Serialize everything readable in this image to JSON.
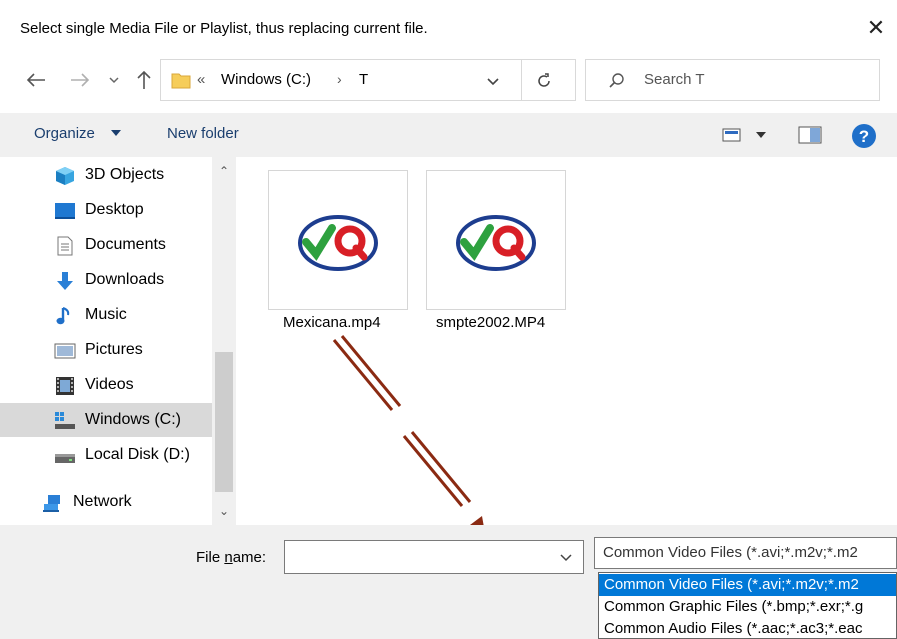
{
  "window": {
    "title": "Select single Media File or Playlist, thus replacing current file."
  },
  "nav": {
    "path_overflow": "«",
    "drive": "Windows (C:)",
    "separator": "›",
    "folder": "T",
    "search_placeholder": "Search T"
  },
  "toolbar": {
    "organize": "Organize",
    "new_folder": "New folder"
  },
  "sidebar": {
    "items": [
      {
        "label": "3D Objects",
        "icon": "3d-objects-icon"
      },
      {
        "label": "Desktop",
        "icon": "desktop-icon"
      },
      {
        "label": "Documents",
        "icon": "documents-icon"
      },
      {
        "label": "Downloads",
        "icon": "downloads-icon"
      },
      {
        "label": "Music",
        "icon": "music-icon"
      },
      {
        "label": "Pictures",
        "icon": "pictures-icon"
      },
      {
        "label": "Videos",
        "icon": "videos-icon"
      },
      {
        "label": "Windows (C:)",
        "icon": "windows-drive-icon",
        "selected": true
      },
      {
        "label": "Local Disk (D:)",
        "icon": "local-disk-icon"
      },
      {
        "label": "Network",
        "icon": "network-icon"
      }
    ]
  },
  "files": [
    {
      "name": "Mexicana.mp4",
      "icon": "vq-media-icon"
    },
    {
      "name": "smpte2002.MP4",
      "icon": "vq-media-icon"
    }
  ],
  "bottom": {
    "file_name_label_pre": "File ",
    "file_name_label_u": "n",
    "file_name_label_post": "ame:",
    "file_name_value": "",
    "file_type_selected": "Common Video Files (*.avi;*.m2v;*.m2",
    "file_type_options": [
      "Common Video Files (*.avi;*.m2v;*.m2",
      "Common Graphic Files (*.bmp;*.exr;*.g",
      "Common Audio Files (*.aac;*.ac3;*.eac"
    ]
  },
  "colors": {
    "accent": "#0078d7",
    "arrow": "#8b2a12",
    "link": "#1a3e6e"
  }
}
